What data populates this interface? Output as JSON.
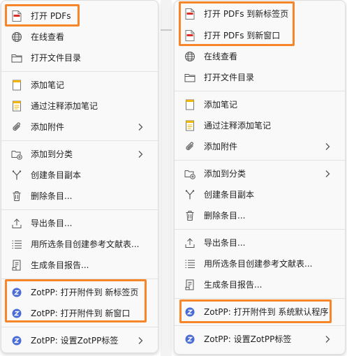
{
  "colors": {
    "highlight": "#f7852a",
    "pdf_red": "#d93025",
    "note_yellow": "#f2b705",
    "zotpp_blue": "#4a6cd4"
  },
  "left_menu": {
    "items": [
      {
        "label": "打开 PDFs",
        "icon": "pdf-icon"
      },
      {
        "label": "在线查看",
        "icon": "globe-icon"
      },
      {
        "label": "打开文件目录",
        "icon": "folder-icon"
      },
      {
        "label": "添加笔记",
        "icon": "note-icon"
      },
      {
        "label": "通过注释添加笔记",
        "icon": "annotation-note-icon"
      },
      {
        "label": "添加附件",
        "icon": "paperclip-icon"
      },
      {
        "label": "添加到分类",
        "icon": "add-collection-icon"
      },
      {
        "label": "创建条目副本",
        "icon": "duplicate-icon"
      },
      {
        "label": "删除条目...",
        "icon": "trash-icon"
      },
      {
        "label": "导出条目...",
        "icon": "export-icon"
      },
      {
        "label": "用所选条目创建参考文献表...",
        "icon": "bibliography-icon"
      },
      {
        "label": "生成条目报告...",
        "icon": "report-icon"
      },
      {
        "label": "ZotPP: 打开附件到 新标签页",
        "icon": "zotpp-icon"
      },
      {
        "label": "ZotPP: 打开附件到 新窗口",
        "icon": "zotpp-icon"
      },
      {
        "label": "ZotPP: 设置ZotPP标签",
        "icon": "zotpp-icon"
      }
    ]
  },
  "right_menu": {
    "items": [
      {
        "label": "打开 PDFs 到新标签页",
        "icon": "pdf-icon"
      },
      {
        "label": "打开 PDFs 到新窗口",
        "icon": "pdf-icon"
      },
      {
        "label": "在线查看",
        "icon": "globe-icon"
      },
      {
        "label": "打开文件目录",
        "icon": "folder-icon"
      },
      {
        "label": "添加笔记",
        "icon": "note-icon"
      },
      {
        "label": "通过注释添加笔记",
        "icon": "annotation-note-icon"
      },
      {
        "label": "添加附件",
        "icon": "paperclip-icon"
      },
      {
        "label": "添加到分类",
        "icon": "add-collection-icon"
      },
      {
        "label": "创建条目副本",
        "icon": "duplicate-icon"
      },
      {
        "label": "删除条目...",
        "icon": "trash-icon"
      },
      {
        "label": "导出条目...",
        "icon": "export-icon"
      },
      {
        "label": "用所选条目创建参考文献表...",
        "icon": "bibliography-icon"
      },
      {
        "label": "生成条目报告...",
        "icon": "report-icon"
      },
      {
        "label": "ZotPP: 打开附件到 系统默认程序",
        "icon": "zotpp-icon"
      },
      {
        "label": "ZotPP: 设置ZotPP标签",
        "icon": "zotpp-icon"
      }
    ]
  }
}
